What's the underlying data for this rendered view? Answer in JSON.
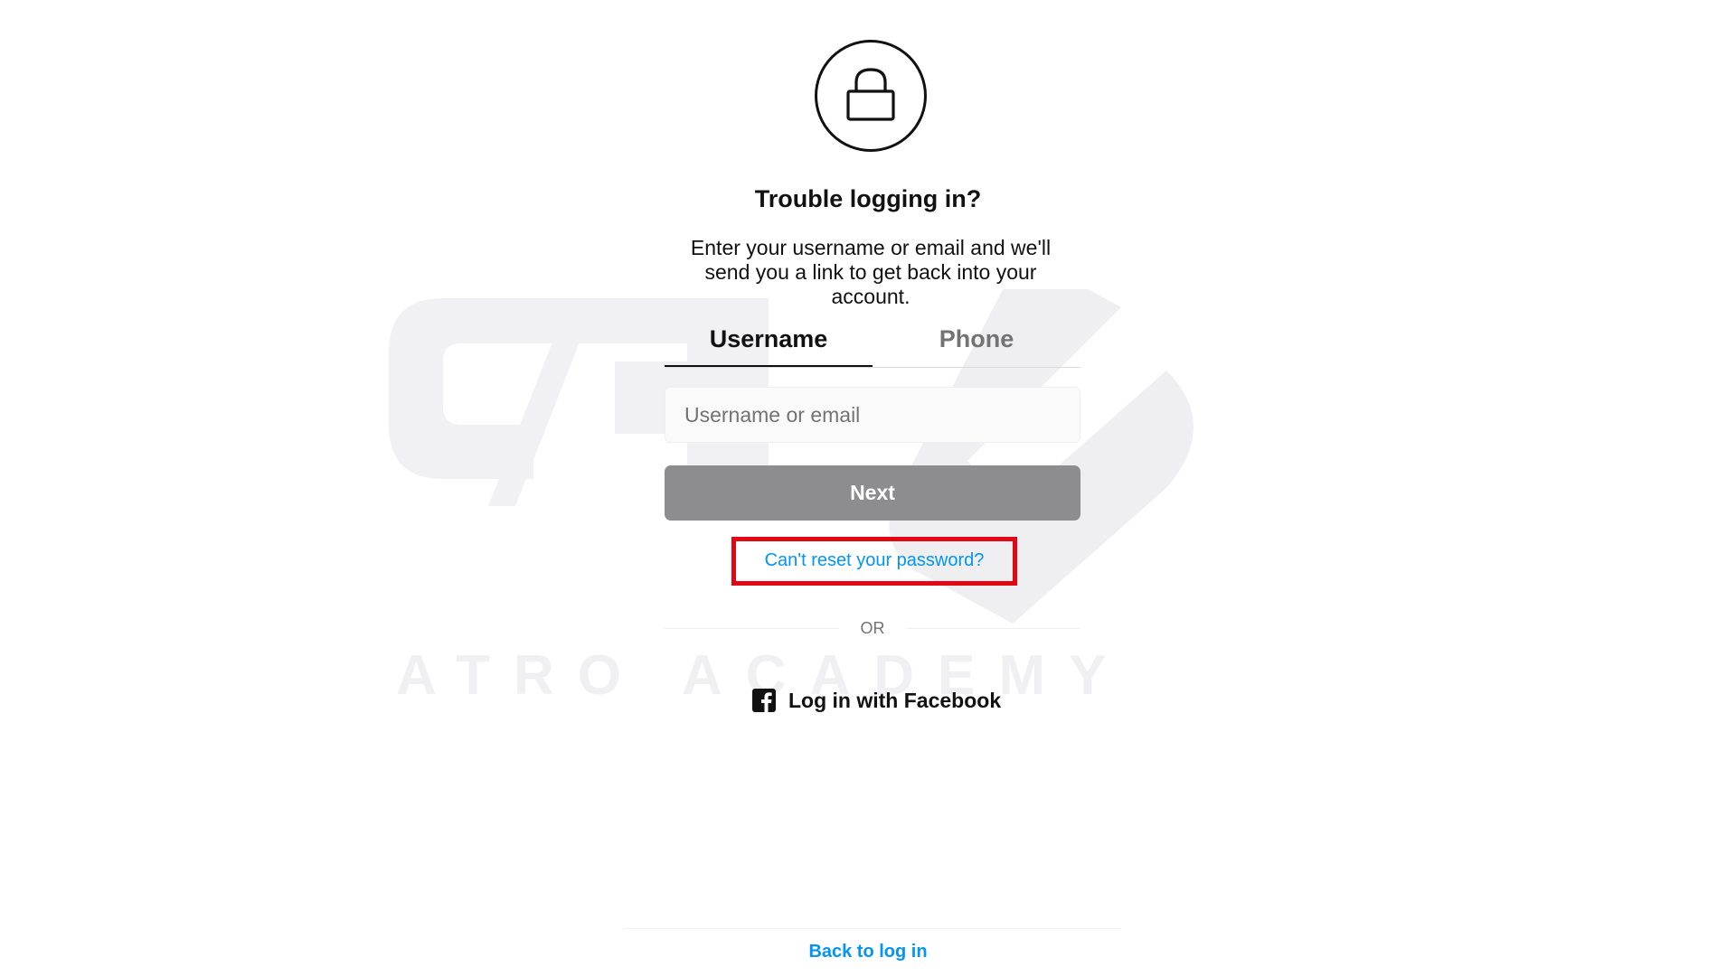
{
  "header": {
    "lock_icon": "lock-icon",
    "title": "Trouble logging in?",
    "description": "Enter your username or email and we'll send you a link to get back into your account."
  },
  "tabs": [
    {
      "label": "Username",
      "active": true
    },
    {
      "label": "Phone",
      "active": false
    }
  ],
  "form": {
    "input_placeholder": "Username or email",
    "input_value": "",
    "next_label": "Next",
    "next_color": "#8d8d8f"
  },
  "links": {
    "reset_label": "Can't reset your password?",
    "highlight_color": "#e30613",
    "link_color": "#0095f6"
  },
  "divider": {
    "or_label": "OR"
  },
  "facebook": {
    "icon": "facebook-icon",
    "label": "Log in with Facebook"
  },
  "footer": {
    "back_label": "Back to log in"
  },
  "watermark": {
    "text": "ATRO ACADEMY"
  }
}
